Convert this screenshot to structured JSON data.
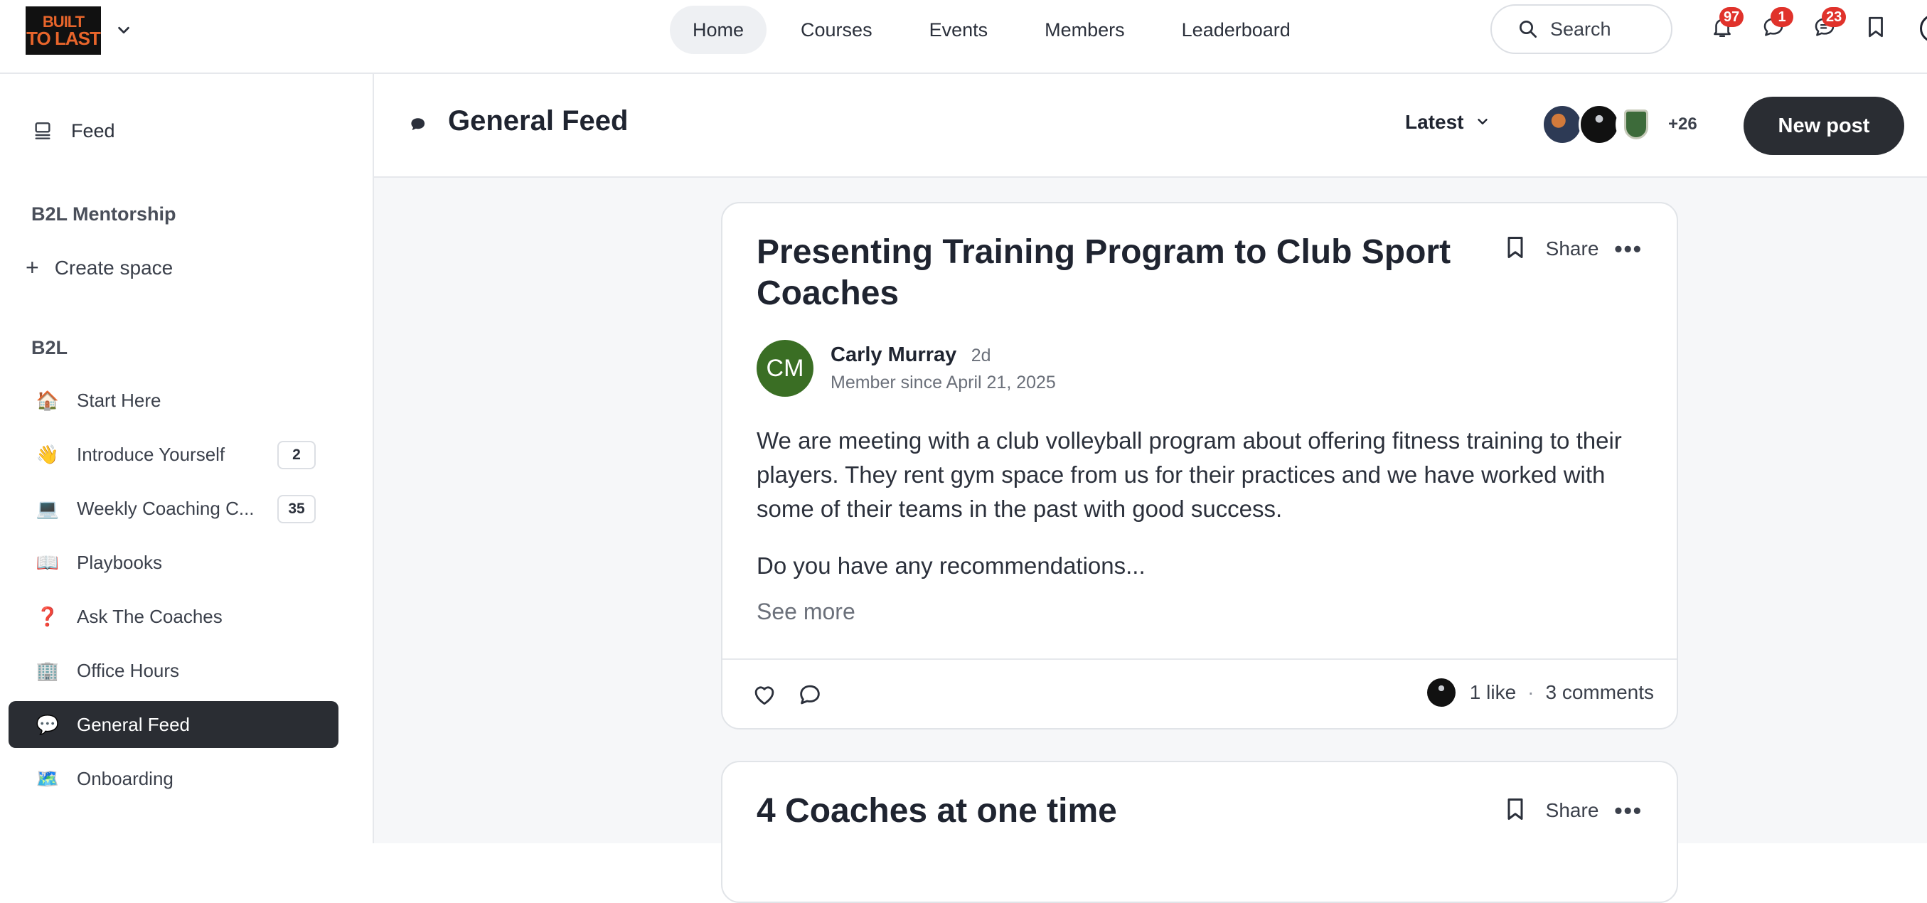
{
  "brand": {
    "logo_line1": "BUILT",
    "logo_line2": "TO LAST"
  },
  "nav": [
    "Home",
    "Courses",
    "Events",
    "Members",
    "Leaderboard"
  ],
  "search": {
    "label": "Search"
  },
  "topbar_badges": {
    "notifications": "97",
    "messages": "1",
    "chat": "23"
  },
  "sidebar": {
    "feed_label": "Feed",
    "section1_title": "B2L Mentorship",
    "create_space": "Create space",
    "section2_title": "B2L",
    "items": [
      {
        "emoji": "🏠",
        "label": "Start Here",
        "count": ""
      },
      {
        "emoji": "👋",
        "label": "Introduce Yourself",
        "count": "2"
      },
      {
        "emoji": "💻",
        "label": "Weekly Coaching C...",
        "count": "35"
      },
      {
        "emoji": "📖",
        "label": "Playbooks",
        "count": ""
      },
      {
        "emoji": "❓",
        "label": "Ask The Coaches",
        "count": ""
      },
      {
        "emoji": "🏢",
        "label": "Office Hours",
        "count": ""
      },
      {
        "emoji": "💬",
        "label": "General Feed",
        "count": ""
      },
      {
        "emoji": "🗺️",
        "label": "Onboarding",
        "count": ""
      }
    ]
  },
  "header": {
    "title": "General Feed",
    "sort": "Latest",
    "member_extra": "+26",
    "new_post": "New post"
  },
  "posts": [
    {
      "title": "Presenting Training Program to Club Sport Coaches",
      "share": "Share",
      "author_initials": "CM",
      "author": "Carly Murray",
      "time": "2d",
      "member_since": "Member since April 21, 2025",
      "paragraph1": "We are meeting with a club volleyball program about offering fitness training to their players. They rent gym space from us for their practices and we have worked with some of their teams in the past with good success.",
      "paragraph2": "Do you have any recommendations...",
      "see_more": "See more",
      "likes": "1 like",
      "comments": "3 comments"
    },
    {
      "title": "4 Coaches at one time",
      "share": "Share"
    }
  ]
}
